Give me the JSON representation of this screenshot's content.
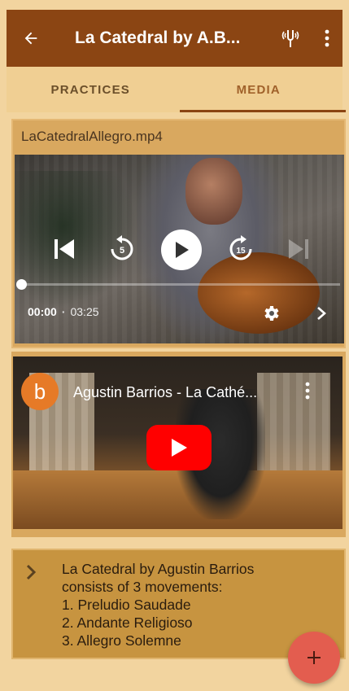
{
  "appbar": {
    "title": "La Catedral by A.B...",
    "back_icon": "arrow-left-icon",
    "action_icon": "tuning-fork-icon",
    "more_icon": "more-vertical-icon",
    "bg_color": "#8b4513"
  },
  "tabs": [
    {
      "label": "PRACTICES",
      "selected": false
    },
    {
      "label": "MEDIA",
      "selected": true
    }
  ],
  "media_file": {
    "filename": "LaCatedralAllegro.mp4",
    "current_time": "00:00",
    "separator": "·",
    "duration": "03:25",
    "progress": 0,
    "rewind_seconds": "5",
    "forward_seconds": "15"
  },
  "youtube": {
    "channel_initial": "b",
    "title": "Agustin Barrios - La Cathé...",
    "avatar_color": "#e67a27"
  },
  "description": {
    "lines": [
      "La Catedral by Agustin Barrios",
      "consists of 3 movements:",
      "1. Preludio Saudade",
      "2. Andante Religioso",
      "3. Allegro Solemne"
    ]
  },
  "fab": {
    "icon": "plus-icon",
    "label": "+",
    "color": "#e35d4f"
  }
}
